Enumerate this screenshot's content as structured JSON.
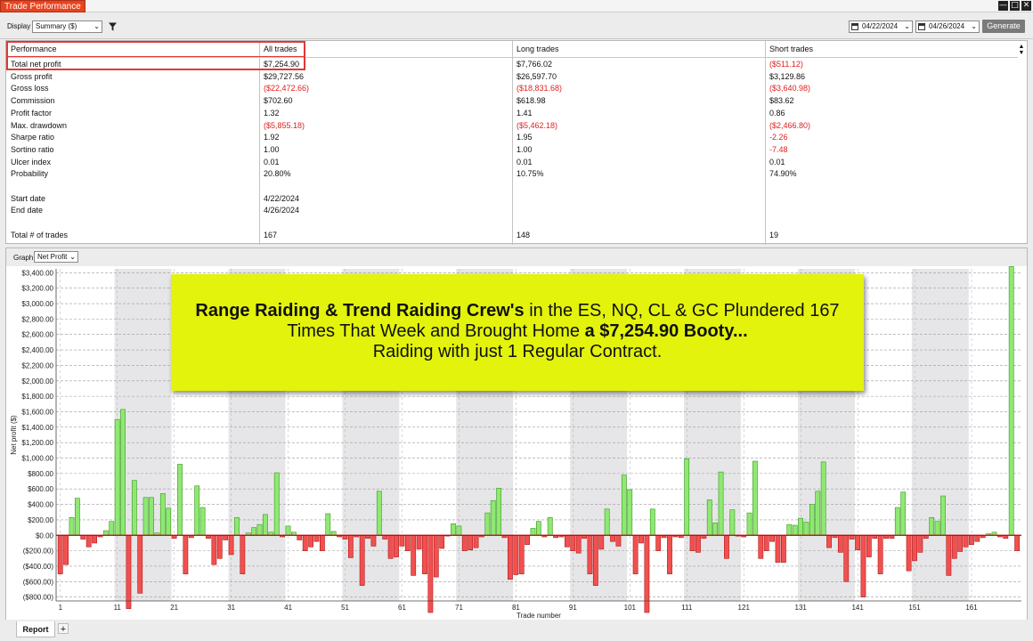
{
  "window": {
    "title": "Trade Performance"
  },
  "toolbar": {
    "display_label": "Display",
    "display_value": "Summary ($)",
    "start_date": "04/22/2024",
    "end_date": "04/26/2024",
    "generate_label": "Generate"
  },
  "table": {
    "headers": [
      "Performance",
      "All trades",
      "Long trades",
      "Short trades"
    ],
    "rows": [
      {
        "label": "Total net profit",
        "all": "$7,254.90",
        "long": "$7,766.02",
        "short": "($511.12)"
      },
      {
        "label": "Gross profit",
        "all": "$29,727.56",
        "long": "$26,597.70",
        "short": "$3,129.86"
      },
      {
        "label": "Gross loss",
        "all": "($22,472.66)",
        "long": "($18,831.68)",
        "short": "($3,640.98)"
      },
      {
        "label": "Commission",
        "all": "$702.60",
        "long": "$618.98",
        "short": "$83.62"
      },
      {
        "label": "Profit factor",
        "all": "1.32",
        "long": "1.41",
        "short": "0.86"
      },
      {
        "label": "Max. drawdown",
        "all": "($5,855.18)",
        "long": "($5,462.18)",
        "short": "($2,466.80)"
      },
      {
        "label": "Sharpe ratio",
        "all": "1.92",
        "long": "1.95",
        "short": "-2.26"
      },
      {
        "label": "Sortino ratio",
        "all": "1.00",
        "long": "1.00",
        "short": "-7.48"
      },
      {
        "label": "Ulcer index",
        "all": "0.01",
        "long": "0.01",
        "short": "0.01"
      },
      {
        "label": "Probability",
        "all": "20.80%",
        "long": "10.75%",
        "short": "74.90%"
      },
      {
        "label": "",
        "all": "",
        "long": "",
        "short": ""
      },
      {
        "label": "Start date",
        "all": "4/22/2024",
        "long": "",
        "short": ""
      },
      {
        "label": "End date",
        "all": "4/26/2024",
        "long": "",
        "short": ""
      },
      {
        "label": "",
        "all": "",
        "long": "",
        "short": ""
      },
      {
        "label": "Total # of trades",
        "all": "167",
        "long": "148",
        "short": "19"
      }
    ]
  },
  "graph": {
    "label": "Graph",
    "select_value": "Net Profit"
  },
  "banner": {
    "line1_bold": "Range Raiding & Trend Raiding Crew's",
    "line1_rest": " in the ES, NQ, CL & GC Plundered 167",
    "line2_start": "Times That Week and Brought Home ",
    "line2_bold": "a $7,254.90 Booty...",
    "line3": "Raiding with just 1 Regular Contract."
  },
  "tabs": {
    "report": "Report",
    "add": "+"
  },
  "colors": {
    "positive_bar": "#8fe872",
    "positive_edge": "#3a9a22",
    "negative_bar": "#f25050",
    "negative_edge": "#b01818",
    "zero_line": "#c00000",
    "band": "#e6e6e8",
    "negative_text": "#e02020"
  },
  "chart_data": {
    "type": "bar",
    "ylabel": "Net profit ($)",
    "xlabel": "Trade number",
    "ylim": [
      -850,
      3450
    ],
    "yticks": [
      "$3,400.00",
      "$3,200.00",
      "$3,000.00",
      "$2,800.00",
      "$2,600.00",
      "$2,400.00",
      "$2,200.00",
      "$2,000.00",
      "$1,800.00",
      "$1,600.00",
      "$1,400.00",
      "$1,200.00",
      "$1,000.00",
      "$800.00",
      "$600.00",
      "$400.00",
      "$200.00",
      "$0.00",
      "($200.00)",
      "($400.00)",
      "($600.00)",
      "($800.00)"
    ],
    "ytick_values": [
      3400,
      3200,
      3000,
      2800,
      2600,
      2400,
      2200,
      2000,
      1800,
      1600,
      1400,
      1200,
      1000,
      800,
      600,
      400,
      200,
      0,
      -200,
      -400,
      -600,
      -800
    ],
    "xticks": [
      1,
      11,
      21,
      31,
      41,
      51,
      61,
      71,
      81,
      91,
      101,
      111,
      121,
      131,
      141,
      151,
      161
    ],
    "values": [
      -500,
      -380,
      230,
      480,
      -50,
      -150,
      -100,
      -20,
      60,
      180,
      1500,
      1630,
      -950,
      710,
      -750,
      490,
      490,
      30,
      540,
      350,
      -40,
      920,
      -500,
      -30,
      640,
      360,
      -40,
      -380,
      -300,
      -60,
      -250,
      230,
      -500,
      30,
      100,
      140,
      270,
      40,
      810,
      -20,
      120,
      40,
      -60,
      -200,
      -150,
      -80,
      -200,
      280,
      50,
      -20,
      -50,
      -290,
      -20,
      -650,
      -40,
      -140,
      570,
      -50,
      -300,
      -280,
      -140,
      -200,
      -520,
      -180,
      -500,
      -1000,
      -540,
      -170,
      -10,
      150,
      120,
      -200,
      -190,
      -160,
      -20,
      290,
      450,
      610,
      -30,
      -570,
      -510,
      -500,
      -120,
      90,
      180,
      -20,
      230,
      -30,
      -20,
      -150,
      -200,
      -230,
      -40,
      -500,
      -650,
      -180,
      340,
      -80,
      -140,
      780,
      590,
      -500,
      -100,
      -1000,
      340,
      -200,
      -30,
      -500,
      -20,
      -30,
      990,
      -200,
      -220,
      -40,
      460,
      160,
      820,
      -300,
      330,
      -10,
      -20,
      290,
      960,
      -300,
      -200,
      -80,
      -350,
      -350,
      140,
      130,
      220,
      170,
      400,
      570,
      950,
      -160,
      -30,
      -220,
      -600,
      -50,
      -190,
      -800,
      -280,
      -40,
      -500,
      -40,
      -40,
      360,
      560,
      -460,
      -330,
      -220,
      -40,
      230,
      180,
      510,
      -520,
      -300,
      -210,
      -150,
      -120,
      -80,
      -30,
      20,
      40,
      -20,
      -40,
      3480,
      -200
    ],
    "series_name": "Net Profit"
  }
}
